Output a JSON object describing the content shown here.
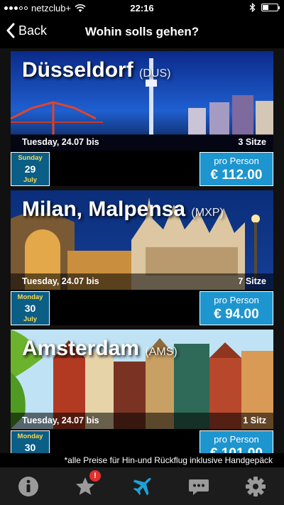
{
  "status_bar": {
    "carrier": "netzclub+",
    "time": "22:16"
  },
  "nav": {
    "back_label": "Back",
    "title": "Wohin solls gehen?"
  },
  "destinations": [
    {
      "city": "Düsseldorf",
      "code": "(DUS)",
      "date": "Tuesday, 24.07 bis",
      "seats": "3 Sitze",
      "return_weekday": "Sunday",
      "return_day": "29",
      "return_month": "July",
      "price_label": "pro Person",
      "price": "€ 112.00"
    },
    {
      "city": "Milan, Malpensa",
      "code": "(MXP)",
      "date": "Tuesday, 24.07 bis",
      "seats": "7 Sitze",
      "return_weekday": "Monday",
      "return_day": "30",
      "return_month": "July",
      "price_label": "pro Person",
      "price": "€ 94.00"
    },
    {
      "city": "Amsterdam",
      "code": "(AMS)",
      "date": "Tuesday, 24.07 bis",
      "seats": "1 Sitz",
      "return_weekday": "Monday",
      "return_day": "30",
      "return_month": "",
      "price_label": "pro Person",
      "price": "€ 101.00"
    }
  ],
  "footnote": "*alle Preise für Hin-und Rückflug inklusive Handgepäck",
  "tabs": [
    {
      "icon": "info-icon"
    },
    {
      "icon": "star-icon",
      "badge": "!"
    },
    {
      "icon": "airplane-icon",
      "active": true
    },
    {
      "icon": "chat-icon"
    },
    {
      "icon": "gear-icon"
    }
  ],
  "colors": {
    "accent": "#1d95cf",
    "return_box": "#0b5e86",
    "return_text": "#ffd84d",
    "active_tab": "#1da1d6",
    "inactive_tab": "#9a9a9a",
    "badge": "#e53030"
  }
}
